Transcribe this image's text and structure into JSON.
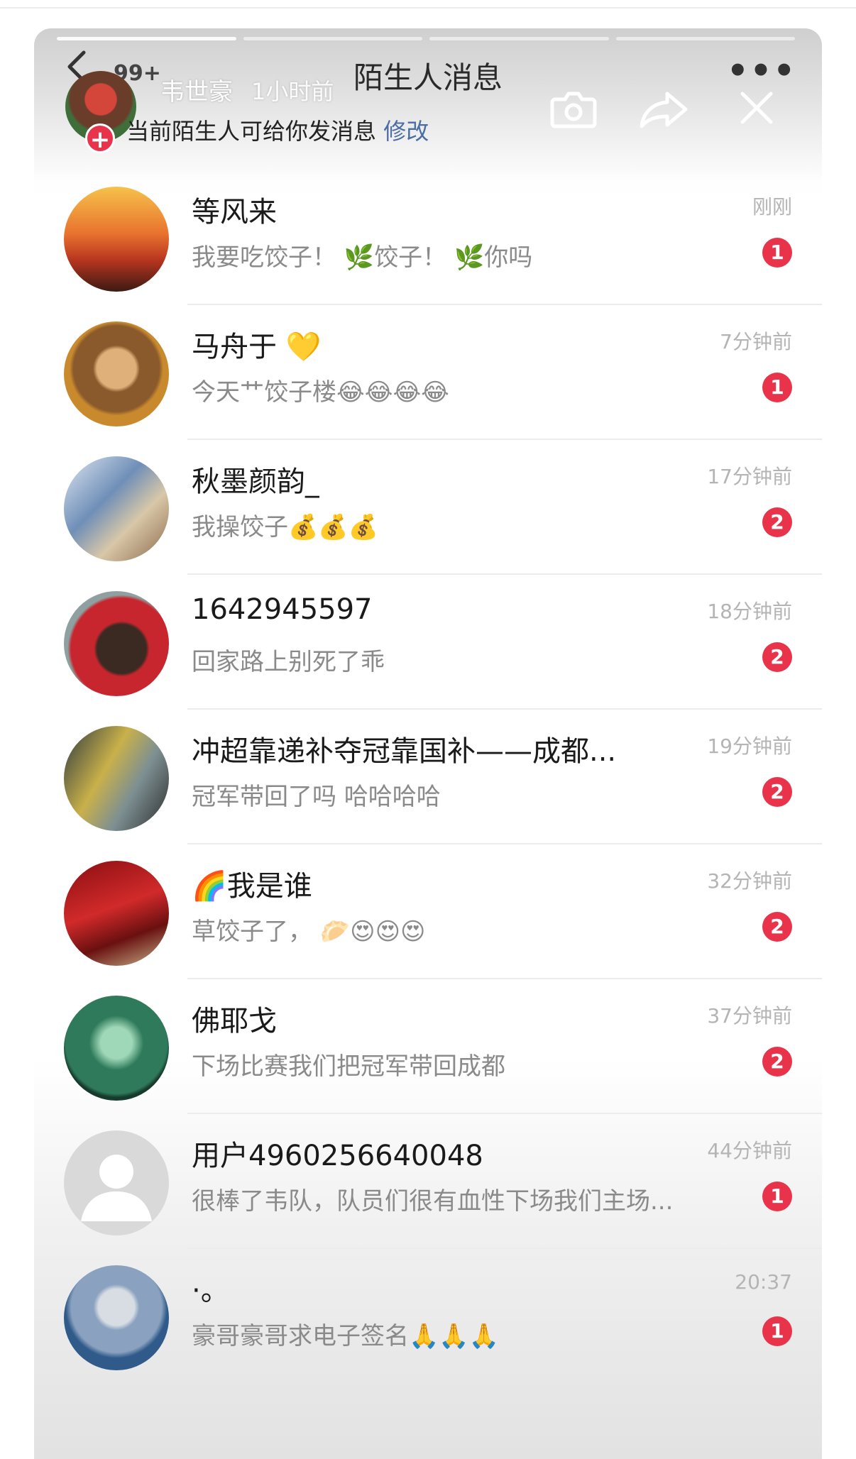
{
  "header": {
    "title": "陌生人消息",
    "back_count": "99+",
    "more": "•••",
    "story_user": "韦世豪",
    "story_time": "1小时前",
    "notice_text": "当前陌生人可给你发消息",
    "notice_link": "修改",
    "icons": [
      "chevron-left-icon",
      "camera-icon",
      "share-icon",
      "close-icon",
      "plus-icon",
      "more-icon"
    ]
  },
  "colors": {
    "accent": "#e8334a",
    "link": "#4a6da3",
    "muted": "#8a8a8a",
    "time": "#b4b4b4"
  },
  "messages": [
    {
      "name": "等风来",
      "preview": "我要吃饺子！ 🌿饺子！ 🌿你吗",
      "time": "刚刚",
      "unread": "1",
      "avatar_style": "sunset"
    },
    {
      "name": "马舟于 💛",
      "preview": "今天艹饺子楼😂😂😂😂",
      "time": "7分钟前",
      "unread": "1",
      "avatar_style": "hood"
    },
    {
      "name": "秋墨颜韵_",
      "preview": "我操饺子💰💰💰",
      "time": "17分钟前",
      "unread": "2",
      "avatar_style": "anime"
    },
    {
      "name": "1642945597",
      "preview": "回家路上别死了乖",
      "time": "18分钟前",
      "unread": "2",
      "avatar_style": "puppet"
    },
    {
      "name": "冲超靠递补夺冠靠国补——成都...",
      "preview": "冠军带回了吗 哈哈哈哈",
      "time": "19分钟前",
      "unread": "2",
      "avatar_style": "fans"
    },
    {
      "name": "🌈我是谁",
      "preview": "草饺子了， 🥟😍😍😍",
      "time": "32分钟前",
      "unread": "2",
      "avatar_style": "flag"
    },
    {
      "name": "佛耶戈",
      "preview": "下场比赛我们把冠军带回成都",
      "time": "37分钟前",
      "unread": "2",
      "avatar_style": "green"
    },
    {
      "name": "用户4960256640048",
      "preview": "很棒了韦队，队员们很有血性下场我们主场...",
      "time": "44分钟前",
      "unread": "1",
      "avatar_style": "default"
    },
    {
      "name": "·。",
      "preview": "豪哥豪哥求电子签名🙏🙏🙏",
      "time": "20:37",
      "unread": "1",
      "avatar_style": "trophy"
    }
  ]
}
